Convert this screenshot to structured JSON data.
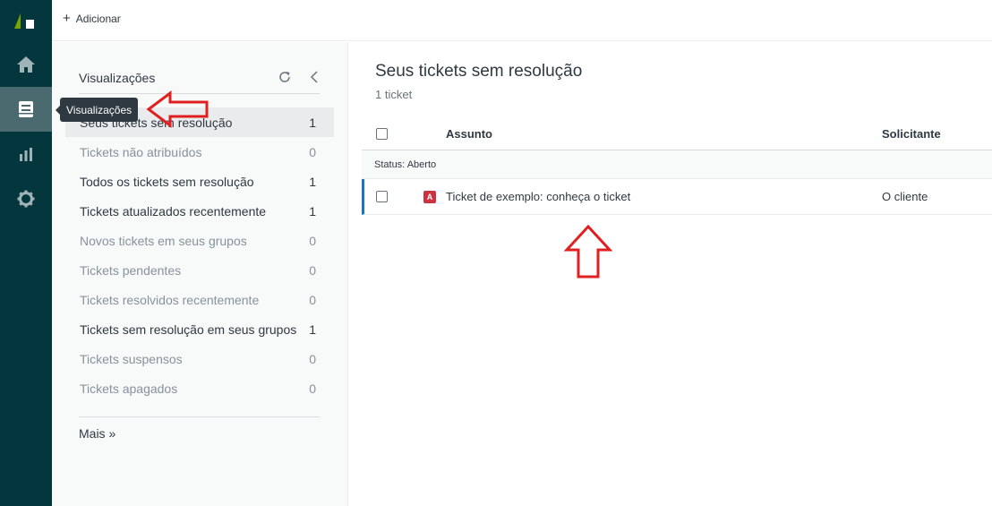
{
  "topbar": {
    "add_label": "Adicionar"
  },
  "tooltip": {
    "text": "Visualizações"
  },
  "views": {
    "title": "Visualizações",
    "items": [
      {
        "label": "Seus tickets sem resolução",
        "count": "1"
      },
      {
        "label": "Tickets não atribuídos",
        "count": "0"
      },
      {
        "label": "Todos os tickets sem resolução",
        "count": "1"
      },
      {
        "label": "Tickets atualizados recentemente",
        "count": "1"
      },
      {
        "label": "Novos tickets em seus grupos",
        "count": "0"
      },
      {
        "label": "Tickets pendentes",
        "count": "0"
      },
      {
        "label": "Tickets resolvidos recentemente",
        "count": "0"
      },
      {
        "label": "Tickets sem resolução em seus grupos",
        "count": "1"
      },
      {
        "label": "Tickets suspensos",
        "count": "0"
      },
      {
        "label": "Tickets apagados",
        "count": "0"
      }
    ],
    "more_label": "Mais »"
  },
  "main": {
    "title": "Seus tickets sem resolução",
    "subtitle": "1 ticket",
    "columns": {
      "subject": "Assunto",
      "requester": "Solicitante"
    },
    "group": {
      "label": "Status:",
      "value": "Aberto"
    },
    "tickets": [
      {
        "status_letter": "A",
        "subject": "Ticket de exemplo: conheça o ticket",
        "requester": "O cliente"
      }
    ]
  },
  "colors": {
    "rail": "#03363d",
    "rail_active": "#4b6a6f",
    "annotation": "#e02020",
    "status_open": "#cc3340",
    "row_accent": "#1f73b7"
  }
}
